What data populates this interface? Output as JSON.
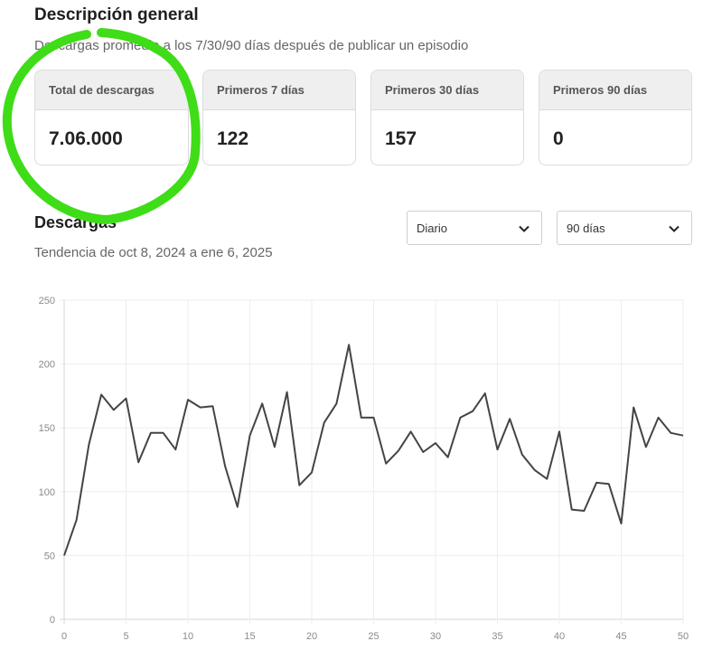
{
  "overview": {
    "title": "Descripción general",
    "subtitle": "Descargas promedio a los 7/30/90 días después de publicar un episodio",
    "cards": [
      {
        "label": "Total de descargas",
        "value": "7.06.000"
      },
      {
        "label": "Primeros 7 días",
        "value": "122"
      },
      {
        "label": "Primeros 30 días",
        "value": "157"
      },
      {
        "label": "Primeros 90 días",
        "value": "0"
      }
    ]
  },
  "downloads": {
    "title": "Descargas",
    "subtitle": "Tendencia de oct 8, 2024 a ene 6, 2025",
    "interval_select": "Diario",
    "range_select": "90 días"
  },
  "annotation": {
    "color": "#3fdc18"
  },
  "chart_data": {
    "type": "line",
    "color": "#444444",
    "grid": true,
    "xlim": [
      0,
      50
    ],
    "ylim": [
      0,
      250
    ],
    "xticks": [
      0,
      5,
      10,
      15,
      20,
      25,
      30,
      35,
      40,
      45,
      50
    ],
    "yticks": [
      0,
      50,
      100,
      150,
      200,
      250
    ],
    "x": [
      0,
      1,
      2,
      3,
      4,
      5,
      6,
      7,
      8,
      9,
      10,
      11,
      12,
      13,
      14,
      15,
      16,
      17,
      18,
      19,
      20,
      21,
      22,
      23,
      24,
      25,
      26,
      27,
      28,
      29,
      30,
      31,
      32,
      33,
      34,
      35,
      36,
      37,
      38,
      39,
      40,
      41,
      42,
      43,
      44,
      45,
      46,
      47,
      48,
      49,
      50
    ],
    "y": [
      50,
      78,
      137,
      176,
      164,
      173,
      123,
      146,
      146,
      133,
      172,
      166,
      167,
      120,
      88,
      144,
      169,
      135,
      178,
      105,
      115,
      154,
      169,
      215,
      158,
      158,
      122,
      132,
      147,
      131,
      138,
      127,
      158,
      163,
      177,
      133,
      157,
      129,
      117,
      110,
      147,
      86,
      85,
      107,
      106,
      75,
      166,
      135,
      158,
      146,
      144
    ]
  }
}
